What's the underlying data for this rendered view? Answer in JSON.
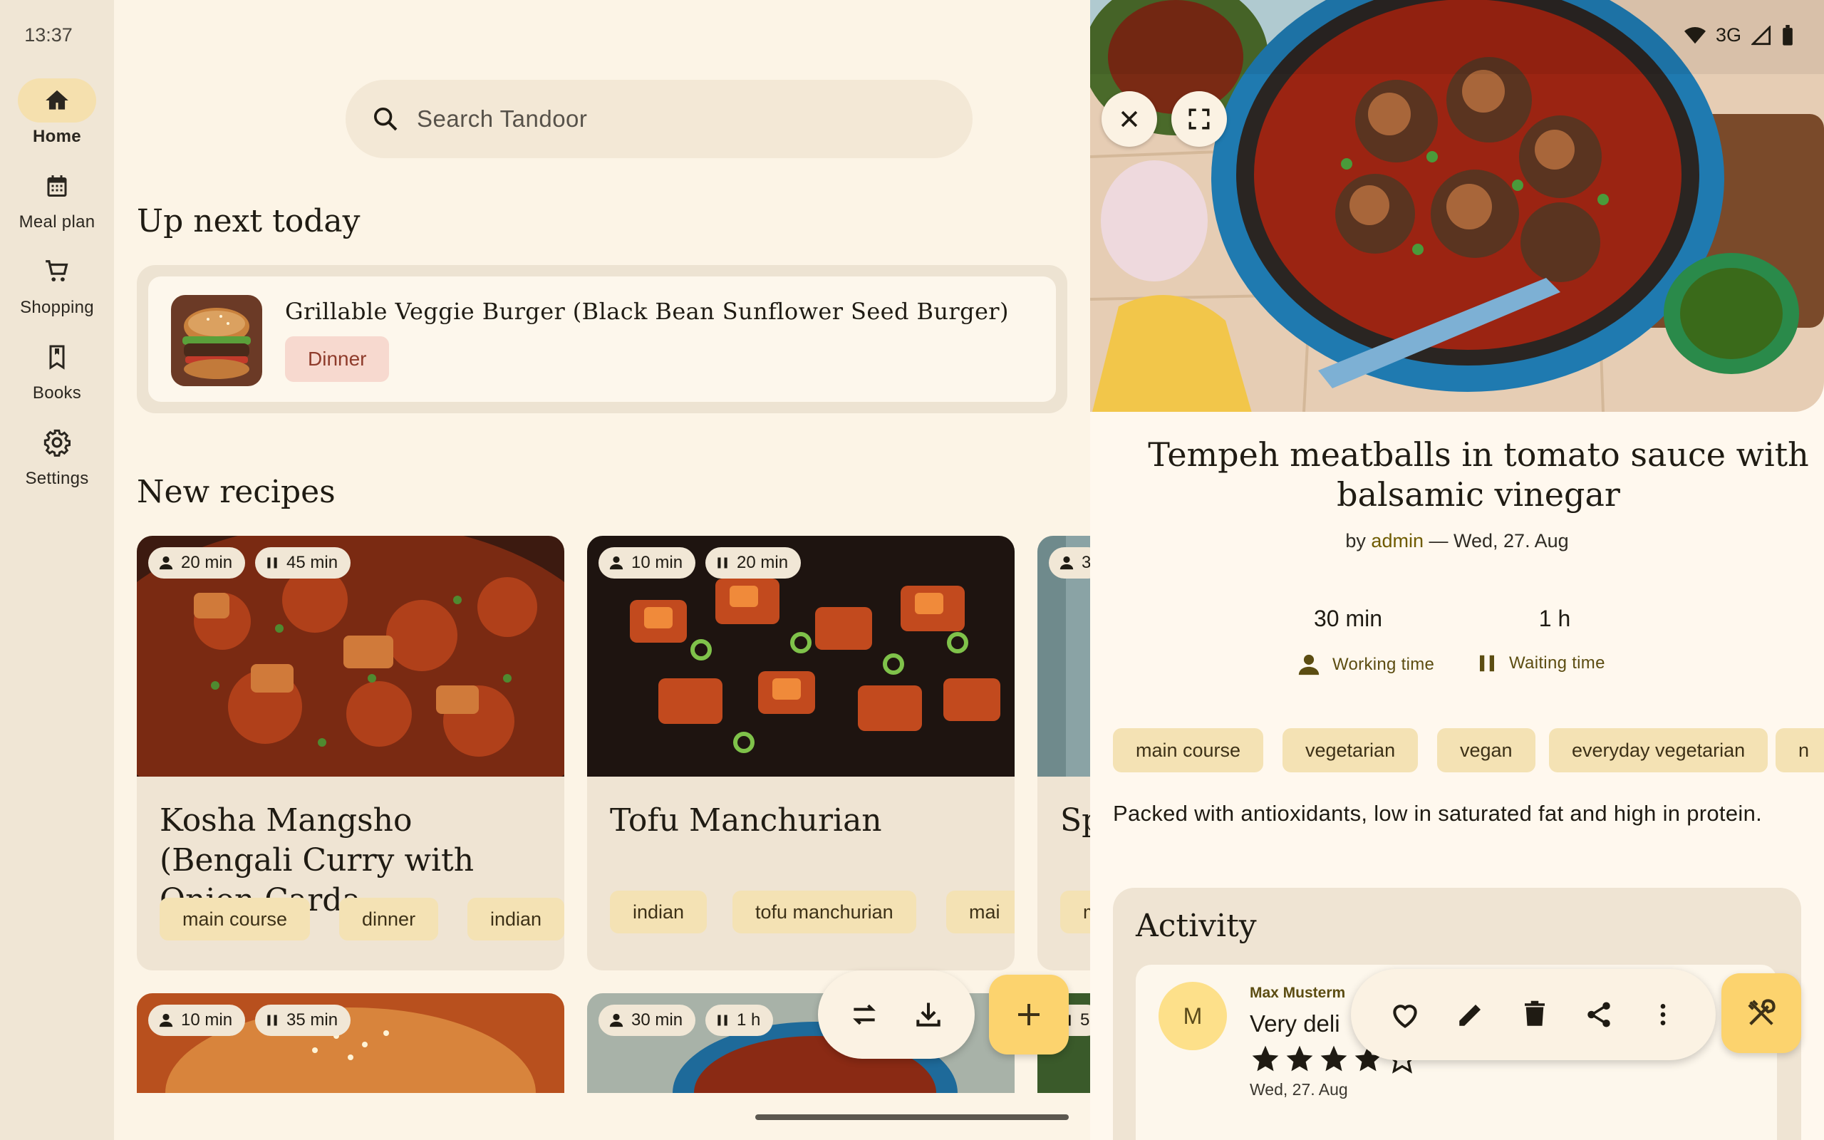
{
  "status": {
    "time": "13:37",
    "network": "3G"
  },
  "nav": {
    "items": [
      {
        "label": "Home",
        "icon": "home-icon",
        "active": true
      },
      {
        "label": "Meal plan",
        "icon": "calendar-icon"
      },
      {
        "label": "Shopping",
        "icon": "cart-icon"
      },
      {
        "label": "Books",
        "icon": "bookmark-icon"
      },
      {
        "label": "Settings",
        "icon": "gear-icon"
      }
    ]
  },
  "search": {
    "placeholder": "Search Tandoor"
  },
  "up_next": {
    "heading": "Up next today",
    "title": "Grillable Veggie Burger (Black Bean Sunflower Seed Burger)",
    "meal_type": "Dinner"
  },
  "new_recipes": {
    "heading": "New recipes",
    "cards": [
      {
        "working": "20 min",
        "waiting": "45 min",
        "title": "Kosha Mangsho (Bengali Curry with Onion Carda...",
        "tags": [
          "main course",
          "dinner",
          "indian"
        ]
      },
      {
        "working": "10 min",
        "waiting": "20 min",
        "title": "Tofu Manchurian",
        "tags": [
          "indian",
          "tofu manchurian",
          "mai"
        ]
      },
      {
        "working": "3",
        "title": "Sp",
        "tags": [
          "m"
        ]
      }
    ],
    "row2": [
      {
        "working": "10 min",
        "waiting": "35 min"
      },
      {
        "working": "30 min",
        "waiting": "1 h"
      },
      {
        "waiting": "5"
      }
    ]
  },
  "detail": {
    "title": "Tempeh meatballs in tomato sauce with balsamic vinegar",
    "by_prefix": "by",
    "author": "admin",
    "date_sep": "—",
    "date": "Wed, 27. Aug",
    "working_time": {
      "value": "30 min",
      "label": "Working time"
    },
    "waiting_time": {
      "value": "1 h",
      "label": "Waiting time"
    },
    "tags": [
      "main course",
      "vegetarian",
      "vegan",
      "everyday vegetarian",
      "n"
    ],
    "description": "Packed with antioxidants, low in saturated fat and high in protein.",
    "activity": {
      "heading": "Activity",
      "comment": {
        "avatar_letter": "M",
        "author": "Max Musterm",
        "text": "Very deli",
        "rating": 4,
        "date": "Wed, 27. Aug"
      }
    }
  },
  "colors": {
    "accent": "#fcd36e",
    "chip": "#f4e2b4",
    "nav_active": "#f5e0ae",
    "background": "#fcf4e6"
  }
}
